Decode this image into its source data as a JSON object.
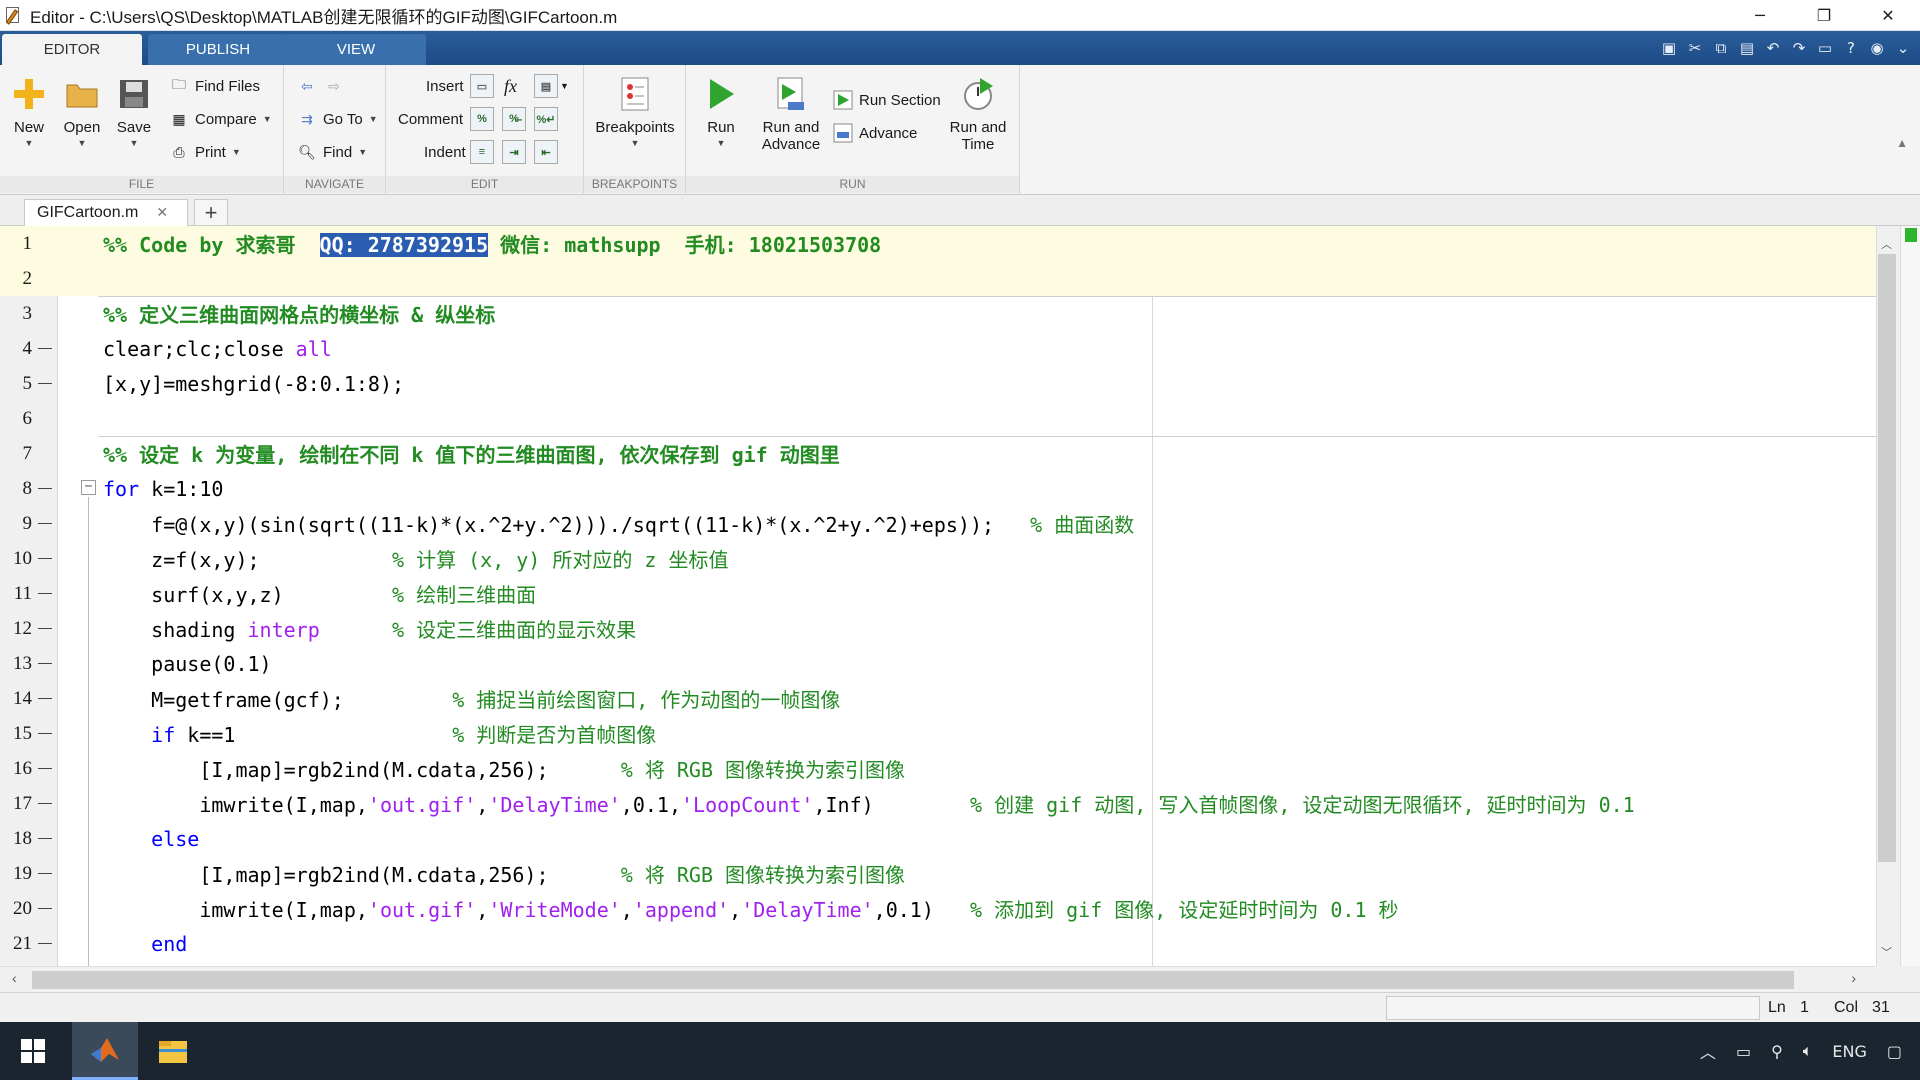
{
  "window": {
    "title": "Editor - C:\\Users\\QS\\Desktop\\MATLAB创建无限循环的GIF动图\\GIFCartoon.m"
  },
  "tabs": [
    "EDITOR",
    "PUBLISH",
    "VIEW"
  ],
  "ribbon": {
    "file": {
      "label": "FILE",
      "new": "New",
      "open": "Open",
      "save": "Save",
      "find_files": "Find Files",
      "compare": "Compare",
      "print": "Print"
    },
    "navigate": {
      "label": "NAVIGATE",
      "goto": "Go To",
      "find": "Find"
    },
    "edit": {
      "label": "EDIT",
      "insert": "Insert",
      "comment": "Comment",
      "indent": "Indent",
      "fx": "fx"
    },
    "breakpoints": {
      "label": "BREAKPOINTS",
      "breakpoints": "Breakpoints"
    },
    "run": {
      "label": "RUN",
      "run": "Run",
      "run_advance_1": "Run and",
      "run_advance_2": "Advance",
      "run_section": "Run Section",
      "advance": "Advance",
      "run_time_1": "Run and",
      "run_time_2": "Time"
    }
  },
  "document_tab": {
    "filename": "GIFCartoon.m"
  },
  "code": {
    "line_numbers": [
      "1",
      "2",
      "3",
      "4",
      "5",
      "6",
      "7",
      "8",
      "9",
      "10",
      "11",
      "12",
      "13",
      "14",
      "15",
      "16",
      "17",
      "18",
      "19",
      "20",
      "21"
    ],
    "l1a": "%% Code by 求索哥  ",
    "l1sel": "QQ: 2787392915",
    "l1b": " 微信: mathsupp  手机: 18021503708",
    "l3": "%% 定义三维曲面网格点的横坐标 & 纵坐标",
    "l4a": "clear;clc;close ",
    "l4b": "all",
    "l5": "[x,y]=meshgrid(-8:0.1:8);",
    "l7": "%% 设定 k 为变量, 绘制在不同 k 值下的三维曲面图, 依次保存到 gif 动图里",
    "l8a": "for",
    "l8b": " k=1:10",
    "l9a": "    f=@(x,y)(sin(sqrt((11-k)*(x.^2+y.^2)))./sqrt((11-k)*(x.^2+y.^2)+eps));   ",
    "l9b": "% 曲面函数",
    "l10a": "    z=f(x,y);           ",
    "l10b": "% 计算 (x, y) 所对应的 z 坐标值",
    "l11a": "    surf(x,y,z)         ",
    "l11b": "% 绘制三维曲面",
    "l12a": "    shading ",
    "l12b": "interp",
    "l12c": "      % 设定三维曲面的显示效果",
    "l13": "    pause(0.1)",
    "l14a": "    M=getframe(gcf);         ",
    "l14b": "% 捕捉当前绘图窗口, 作为动图的一帧图像",
    "l15a": "    if",
    "l15b": " k==1                  ",
    "l15c": "% 判断是否为首帧图像",
    "l16a": "        [I,map]=rgb2ind(M.cdata,256);      ",
    "l16b": "% 将 RGB 图像转换为索引图像",
    "l17a": "        imwrite(I,map,",
    "l17s1": "'out.gif'",
    "l17c1": ",",
    "l17s2": "'DelayTime'",
    "l17c2": ",0.1,",
    "l17s3": "'LoopCount'",
    "l17c3": ",Inf)        ",
    "l17cm": "% 创建 gif 动图, 写入首帧图像, 设定动图无限循环, 延时时间为 0.1",
    "l18": "    else",
    "l19a": "        [I,map]=rgb2ind(M.cdata,256);      ",
    "l19b": "% 将 RGB 图像转换为索引图像",
    "l20a": "        imwrite(I,map,",
    "l20s1": "'out.gif'",
    "l20c1": ",",
    "l20s2": "'WriteMode'",
    "l20c2": ",",
    "l20s3": "'append'",
    "l20c3": ",",
    "l20s4": "'DelayTime'",
    "l20c4": ",0.1)   ",
    "l20cm": "% 添加到 gif 图像, 设定延时时间为 0.1 秒",
    "l21": "    end"
  },
  "status": {
    "ln_label": "Ln",
    "ln": "1",
    "col_label": "Col",
    "col": "31"
  },
  "taskbar": {
    "lang": "ENG"
  },
  "colors": {
    "keyword": "#0000ff",
    "string": "#a020f0",
    "comment": "#228b22",
    "selection": "#2a5db0",
    "ribbon_tab": "#1d4c87"
  }
}
